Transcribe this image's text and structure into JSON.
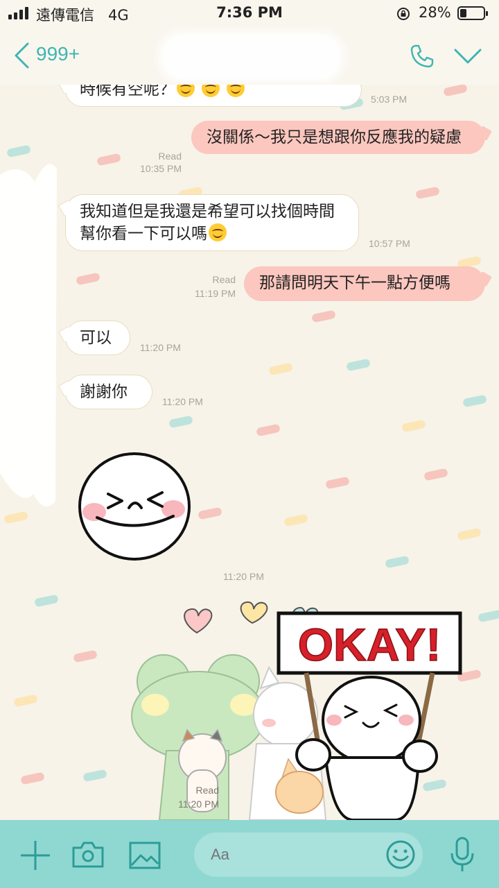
{
  "status_bar": {
    "carrier": "遠傳電信",
    "network": "4G",
    "time": "7:36 PM",
    "battery": "28%",
    "battery_level": 0.28
  },
  "header": {
    "unread_count": "999+"
  },
  "messages": [
    {
      "side": "in",
      "text": "時候有空呢？",
      "emoji_count": 3,
      "time": "5:03 PM"
    },
    {
      "side": "out",
      "text": "沒關係～我只是想跟你反應我的疑慮",
      "read": "Read",
      "time": "10:35 PM"
    },
    {
      "side": "in",
      "text": "我知道但是我還是希望可以找個時間幫你看一下可以嗎",
      "emoji_count": 1,
      "time": "10:57 PM"
    },
    {
      "side": "out",
      "text": "那請問明天下午一點方便嗎",
      "read": "Read",
      "time": "11:19 PM"
    },
    {
      "side": "in",
      "text": "可以",
      "time": "11:20 PM"
    },
    {
      "side": "in",
      "text": "謝謝你",
      "time": "11:20 PM"
    },
    {
      "side": "in",
      "sticker": "laughing-face-sticker",
      "time": "11:20 PM"
    },
    {
      "side": "out",
      "sticker": "okay-sign-sticker",
      "sticker_text": "OKAY!",
      "read": "Read",
      "time": "11:20 PM"
    }
  ],
  "input_bar": {
    "placeholder": "Aa"
  },
  "colors": {
    "accent": "#3fb5b0",
    "outgoing_bubble": "#fbc7bf",
    "incoming_bubble": "#ffffff",
    "input_bar": "#8fd8d2",
    "chat_background": "#f7f3e8"
  }
}
